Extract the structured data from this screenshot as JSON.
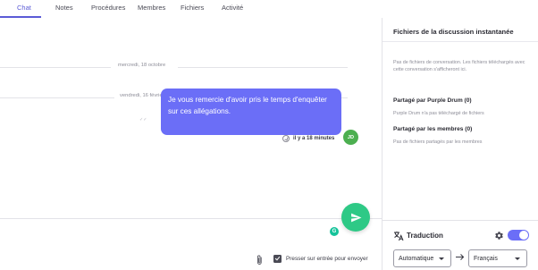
{
  "tabs": [
    {
      "label": "Chat",
      "active": true
    },
    {
      "label": "Notes"
    },
    {
      "label": "Procédures"
    },
    {
      "label": "Membres"
    },
    {
      "label": "Fichiers"
    },
    {
      "label": "Activité"
    }
  ],
  "chat": {
    "day_separators": [
      "mercredi, 18 octobre",
      "vendredi, 16 février"
    ],
    "read_tick": "✓✓",
    "message": {
      "text": "Je vous remercie d'avoir pris le temps d'enquêter sur ces allégations.",
      "time": "il y a 18 minutes",
      "avatar_initials": "JD"
    },
    "grammarly_badge": "G",
    "press_enter_label": "Presser sur entrée pour envoyer",
    "press_enter_checked": true
  },
  "sidebar": {
    "title": "Fichiers de la discussion instantanée",
    "no_files_text": "Pas de fichiers de conversation. Les fichiers téléchargés avec cette conversation s'afficheront ici.",
    "shared_by_user_heading": "Partagé par Purple Drum (0)",
    "shared_by_user_text": "Purple Drum n'a pas téléchargé de fichiers",
    "shared_by_members_heading": "Partagé par les membres (0)",
    "shared_by_members_text": "Pas de fichiers partagés par les membres",
    "translation": {
      "label": "Traduction",
      "enabled": true,
      "source_language": "Automatique",
      "target_language": "Français"
    }
  },
  "colors": {
    "accent": "#6b6ef7",
    "send_button": "#2ec986",
    "avatar": "#4caf50"
  },
  "icons": {
    "send": "send-icon",
    "attach": "paperclip-icon",
    "translate": "translate-icon",
    "settings": "gear-icon",
    "arrow": "arrow-right-icon"
  }
}
